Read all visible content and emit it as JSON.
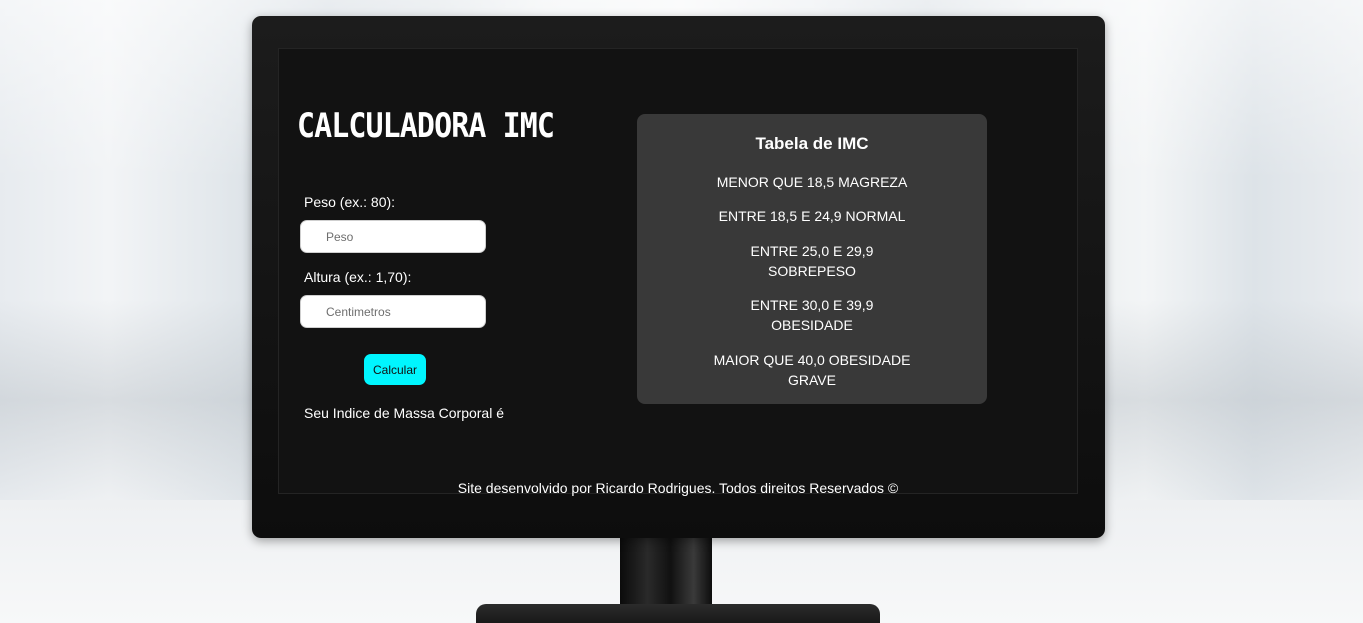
{
  "app": {
    "title": "CALCULADORA IMC"
  },
  "form": {
    "peso_label": "Peso (ex.: 80):",
    "peso_placeholder": "Peso",
    "altura_label": "Altura (ex.: 1,70):",
    "altura_placeholder": "Centimetros",
    "calcular_label": "Calcular",
    "result_text": "Seu Indice de Massa Corporal é"
  },
  "imc_table": {
    "title": "Tabela de IMC",
    "rows": [
      "MENOR QUE 18,5 MAGREZA",
      "ENTRE 18,5 E 24,9 NORMAL",
      "ENTRE 25,0 E 29,9 SOBREPESO",
      "ENTRE 30,0 E 39,9 OBESIDADE",
      "MAIOR QUE 40,0 OBESIDADE GRAVE"
    ]
  },
  "footer": {
    "text": "Site desenvolvido por Ricardo Rodrigues. Todos direitos Reservados ©"
  },
  "colors": {
    "accent": "#00f6ff",
    "panel": "#393939",
    "screen": "#121212"
  }
}
